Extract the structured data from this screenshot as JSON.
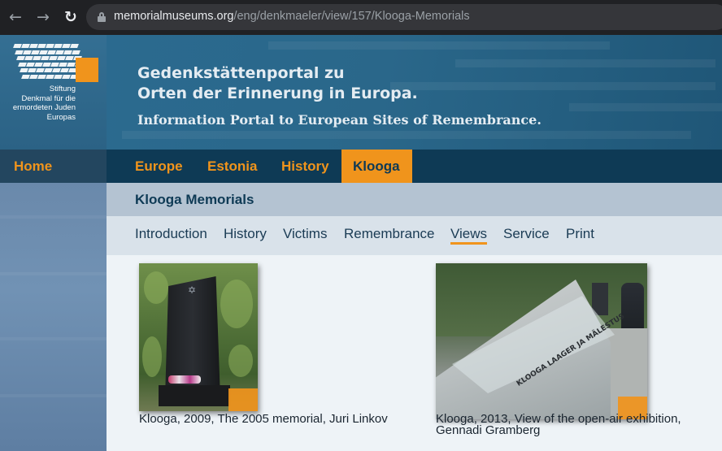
{
  "browser": {
    "url_domain": "memorialmuseums.org",
    "url_path": "/eng/denkmaeler/view/157/Klooga-Memorials"
  },
  "header": {
    "logo_text_lines": [
      "Stiftung",
      "Denkmal für die",
      "ermordeten Juden",
      "Europas"
    ],
    "title_de_line1": "Gedenkstättenportal zu",
    "title_de_line2": "Orten der Erinnerung in Europa.",
    "title_en": "Information Portal to European Sites of Remembrance."
  },
  "mainnav": {
    "home": "Home",
    "items": [
      "Europe",
      "Estonia",
      "History",
      "Klooga"
    ],
    "active_index": 3
  },
  "page": {
    "title": "Klooga Memorials",
    "subnav": [
      "Introduction",
      "History",
      "Victims",
      "Remembrance",
      "Views",
      "Service",
      "Print"
    ],
    "subnav_active_index": 4
  },
  "gallery": [
    {
      "caption": "Klooga, 2009, The 2005 memorial, Juri Linkov"
    },
    {
      "caption_line1": "Klooga, 2013, View of the open-air exhibition,",
      "caption_line2": "Gennadi Gramberg",
      "exhibit_text": "KLOOGA LAAGER JA MÄLESTUS"
    }
  ],
  "colors": {
    "accent": "#f0941c",
    "nav_bg": "#0e3a55",
    "header_bg": "#2a678a"
  }
}
